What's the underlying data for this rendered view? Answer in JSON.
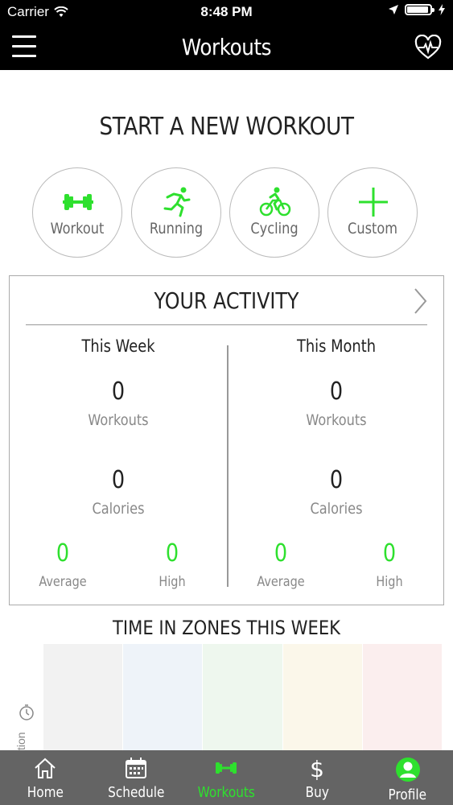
{
  "status_bar": {
    "carrier": "Carrier",
    "time": "8:48 PM"
  },
  "nav": {
    "title": "Workouts",
    "menu_icon": "hamburger-menu-icon",
    "right_icon": "heart-pulse-icon"
  },
  "start_section": {
    "title": "START A NEW WORKOUT",
    "types": [
      {
        "label": "Workout",
        "icon": "dumbbell-icon"
      },
      {
        "label": "Running",
        "icon": "runner-icon"
      },
      {
        "label": "Cycling",
        "icon": "cyclist-icon"
      },
      {
        "label": "Custom",
        "icon": "plus-icon"
      }
    ]
  },
  "activity": {
    "title": "YOUR ACTIVITY",
    "week": {
      "title": "This Week",
      "workouts_value": "0",
      "workouts_label": "Workouts",
      "calories_value": "0",
      "calories_label": "Calories",
      "average_value": "0",
      "average_label": "Average",
      "high_value": "0",
      "high_label": "High"
    },
    "month": {
      "title": "This Month",
      "workouts_value": "0",
      "workouts_label": "Workouts",
      "calories_value": "0",
      "calories_label": "Calories",
      "average_value": "0",
      "average_label": "Average",
      "high_value": "0",
      "high_label": "High"
    }
  },
  "zones": {
    "title": "TIME IN ZONES THIS WEEK",
    "axis_label": "tion",
    "zone_colors": [
      "#f2f2f2",
      "#eef3f9",
      "#eef7ee",
      "#fbf7ea",
      "#fbeeee"
    ]
  },
  "tab_bar": {
    "tabs": [
      {
        "label": "Home",
        "icon": "home-icon"
      },
      {
        "label": "Schedule",
        "icon": "calendar-icon"
      },
      {
        "label": "Workouts",
        "icon": "dumbbell-icon"
      },
      {
        "label": "Buy",
        "icon": "dollar-icon"
      },
      {
        "label": "Profile",
        "icon": "profile-icon"
      }
    ],
    "active_color": "#2ee02e"
  }
}
